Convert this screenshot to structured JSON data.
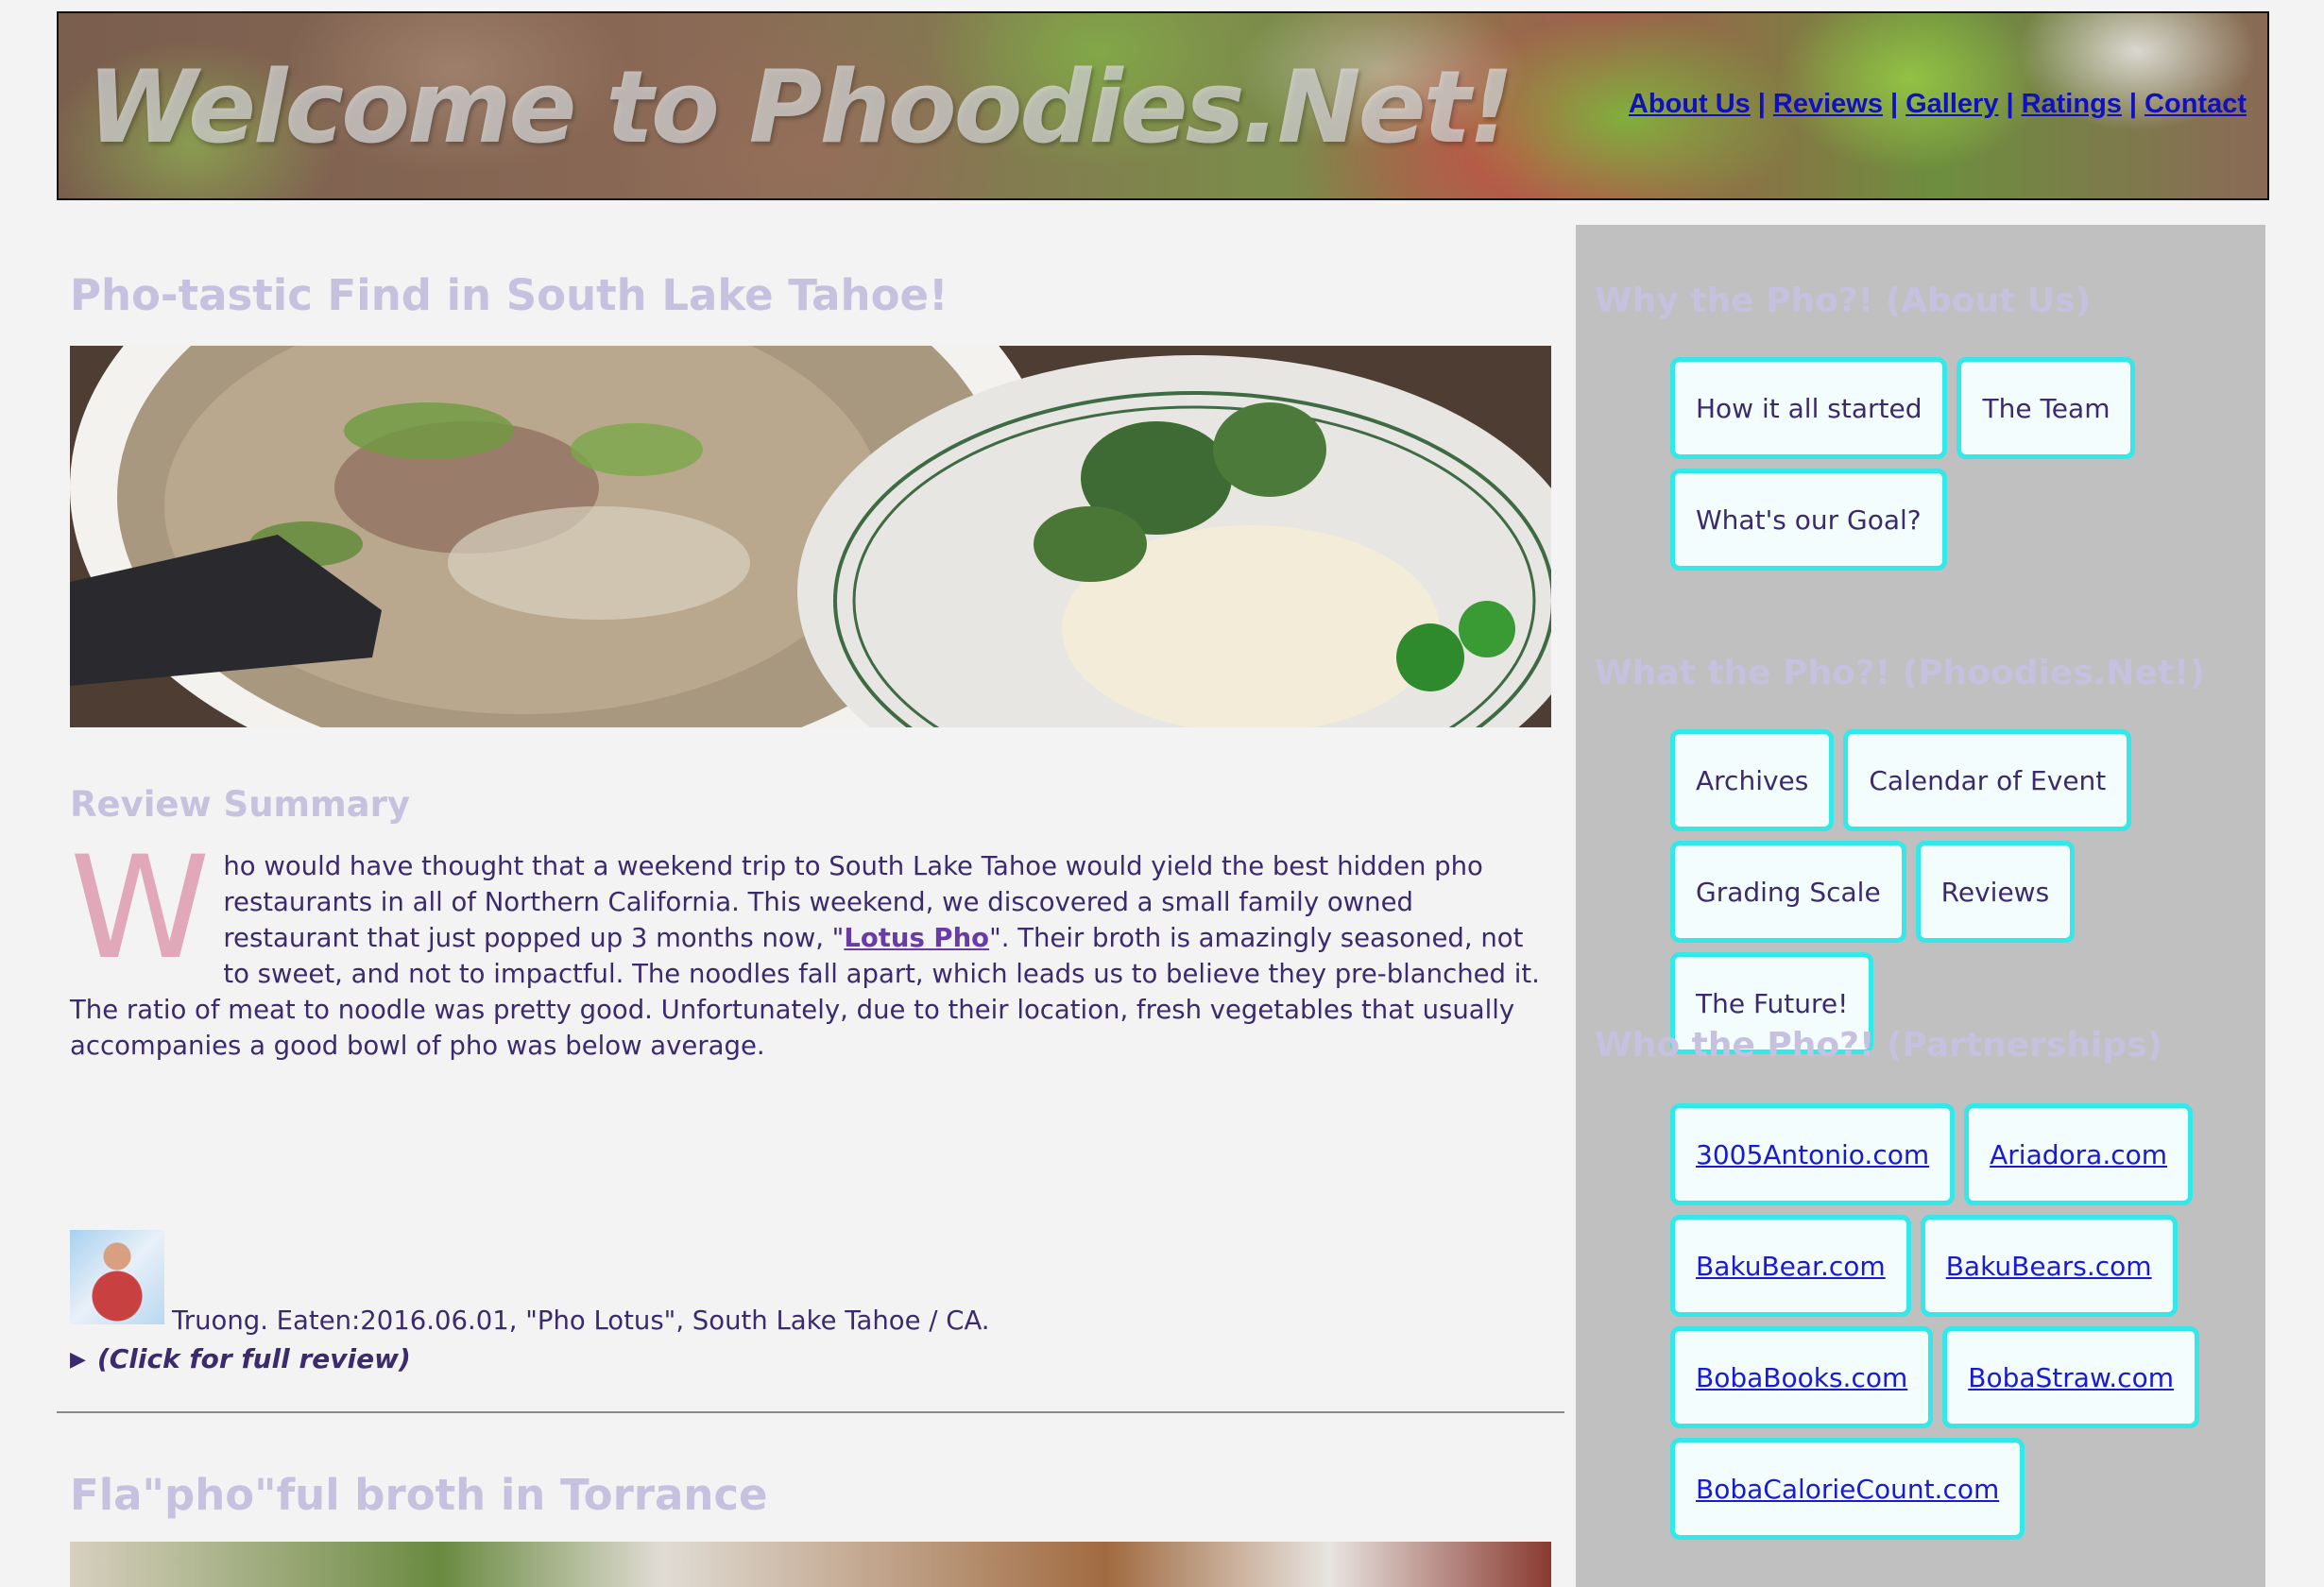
{
  "banner": {
    "title": "Welcome to Phoodies.Net!"
  },
  "top_nav": {
    "items": [
      "About Us",
      "Reviews",
      "Gallery",
      "Ratings",
      "Contact"
    ],
    "separator": "|"
  },
  "posts": [
    {
      "title": "Pho-tastic Find in South Lake Tahoe!",
      "summary_heading": "Review Summary",
      "summary_dropcap": "W",
      "summary_text_before_link": "ho would have thought that a weekend trip to South Lake Tahoe would yield the best hidden pho restaurants in all of Northern California. This weekend, we discovered a small family owned restaurant that just popped up 3 months now, \"",
      "summary_link": "Lotus Pho",
      "summary_text_after_link": "\". Their broth is amazingly seasoned, not to sweet, and not to impactful. The noodles fall apart, which leads us to believe they pre-blanched it. The ratio of meat to noodle was pretty good. Unfortunately, due to their location, fresh vegetables that usually accompanies a good bowl of pho was below average.",
      "full_review_toggle": "(Click for full review)",
      "byline": "Truong. Eaten:2016.06.01, \"Pho Lotus\", South Lake Tahoe / CA."
    },
    {
      "title": "Fla\"pho\"ful broth in Torrance"
    }
  ],
  "sidebar": {
    "sections": [
      {
        "heading": "Why the Pho?! (About Us)",
        "buttons": [
          "How it all started",
          "The Team",
          "What's our Goal?"
        ]
      },
      {
        "heading": "What the Pho?! (Phoodies.Net!)",
        "buttons": [
          "Archives",
          "Calendar of Event",
          "Grading Scale",
          "Reviews",
          "The Future!"
        ]
      },
      {
        "heading": "Who the Pho?! (Partnerships)",
        "links": [
          "3005Antonio.com",
          "Ariadora.com",
          "BakuBear.com",
          "BakuBears.com",
          "BobaBooks.com",
          "BobaStraw.com",
          "BobaCalorieCount.com"
        ]
      }
    ]
  },
  "colors": {
    "page_background": "#f3f3f3",
    "heading_lavender": "#c5c1de",
    "body_text": "#3b2a6e",
    "sidebar_background": "#c0c0c0",
    "button_border": "#33e8e8",
    "button_background": "#f3fdfd",
    "link_blue": "#1010c0",
    "dropcap_pink": "#e0a8b8"
  }
}
